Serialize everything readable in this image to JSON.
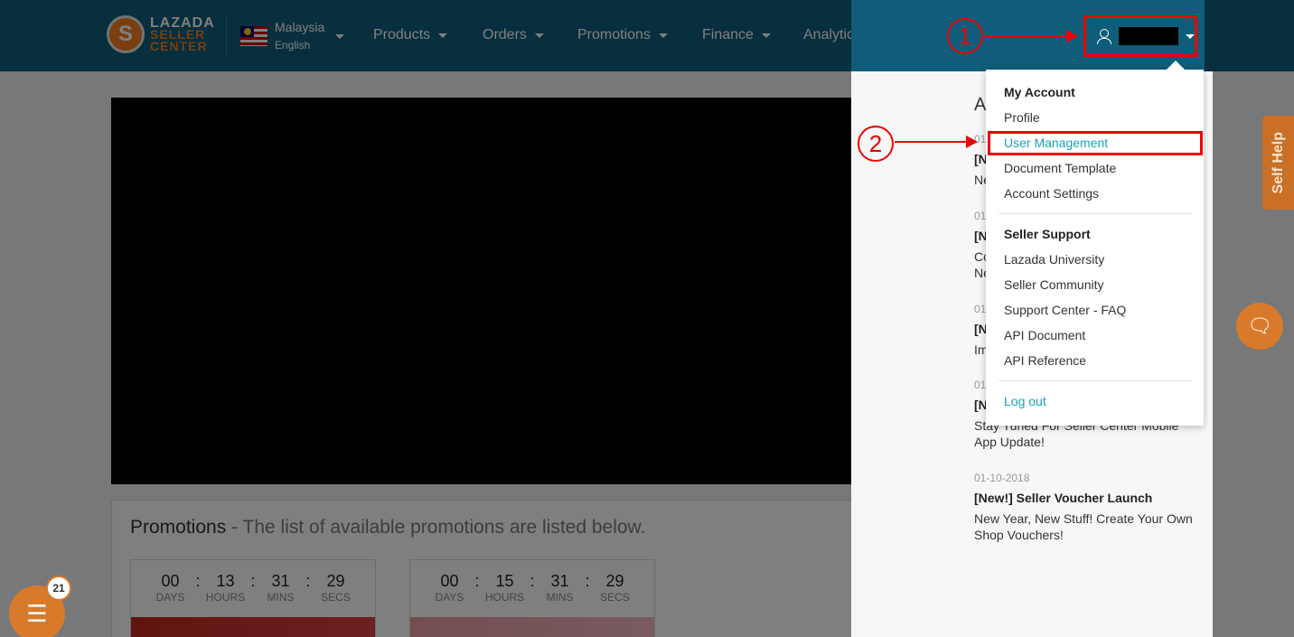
{
  "brand": {
    "line1": "LAZADA",
    "line2": "SELLER",
    "line3": "CENTER",
    "mark": "S"
  },
  "locale": {
    "country": "Malaysia",
    "language": "English"
  },
  "nav": [
    "Products",
    "Orders",
    "Promotions",
    "Finance",
    "Analytics"
  ],
  "user_menu": {
    "sections": [
      {
        "heading": "My Account",
        "items": [
          "Profile",
          "User Management",
          "Document Template",
          "Account Settings"
        ]
      },
      {
        "heading": "Seller Support",
        "items": [
          "Lazada University",
          "Seller Community",
          "Support Center - FAQ",
          "API Document",
          "API Reference"
        ]
      }
    ],
    "logout": "Log out"
  },
  "annotations": {
    "step1": "1",
    "step2": "2"
  },
  "promotions": {
    "title": "Promotions",
    "subtitle": " - The list of available promotions are listed below.",
    "cards": [
      {
        "days": "00",
        "hours": "13",
        "mins": "31",
        "secs": "29"
      },
      {
        "days": "00",
        "hours": "15",
        "mins": "31",
        "secs": "29"
      }
    ],
    "labels": {
      "days": "DAYS",
      "hours": "HOURS",
      "mins": "MINS",
      "secs": "SECS"
    },
    "separator": ":"
  },
  "announcements": {
    "title": "A",
    "items": [
      {
        "date": "01",
        "headline": "[N",
        "body": "Ne"
      },
      {
        "date": "01",
        "headline": "[N",
        "body": "Co\nNe"
      },
      {
        "date": "01",
        "headline": "[N",
        "body": "Im"
      },
      {
        "date": "01",
        "headline": "[N",
        "body": "Stay Tuned For Seller Center Mobile App Update!"
      },
      {
        "date": "01-10-2018",
        "headline": "[New!] Seller Voucher Launch",
        "body": "New Year, New Stuff! Create Your Own Shop Vouchers!"
      }
    ]
  },
  "self_help": "Self Help",
  "task_badge": "21",
  "colors": {
    "topbar": "#0f5e7c",
    "accent": "#f47c20",
    "link": "#1aa1b8",
    "annotation": "#ee0000"
  }
}
